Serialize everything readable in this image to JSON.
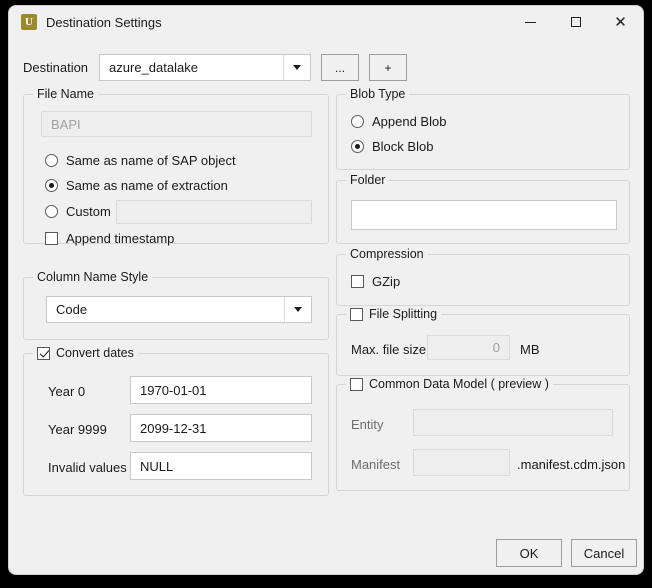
{
  "window": {
    "title": "Destination Settings",
    "app_icon": "u-logo-icon",
    "controls": {
      "minimize": "minimize-icon",
      "maximize": "maximize-icon",
      "close": "close-icon"
    }
  },
  "destination": {
    "label": "Destination",
    "value": "azure_datalake",
    "browse_label": "...",
    "add_label": "+"
  },
  "file_name": {
    "title": "File Name",
    "preview_value": "BAPI",
    "options": [
      {
        "label": "Same as name of SAP object",
        "checked": false
      },
      {
        "label": "Same as name of extraction",
        "checked": true
      },
      {
        "label": "Custom",
        "checked": false
      }
    ],
    "custom_value": "",
    "append_timestamp": {
      "label": "Append timestamp",
      "checked": false
    }
  },
  "column_name_style": {
    "title": "Column Name Style",
    "value": "Code"
  },
  "convert_dates": {
    "title": "Convert dates",
    "checked": true,
    "fields": [
      {
        "label": "Year 0",
        "value": "1970-01-01"
      },
      {
        "label": "Year 9999",
        "value": "2099-12-31"
      },
      {
        "label": "Invalid values",
        "value": "NULL"
      }
    ]
  },
  "blob_type": {
    "title": "Blob Type",
    "options": [
      {
        "label": "Append Blob",
        "checked": false
      },
      {
        "label": "Block Blob",
        "checked": true
      }
    ]
  },
  "folder": {
    "title": "Folder",
    "value": ""
  },
  "compression": {
    "title": "Compression",
    "gzip": {
      "label": "GZip",
      "checked": false
    }
  },
  "file_splitting": {
    "title": "File Splitting",
    "checked": false,
    "max_size_label": "Max. file size",
    "max_size_value": "0",
    "unit": "MB"
  },
  "common_data_model": {
    "title": "Common Data Model ( preview )",
    "checked": false,
    "entity_label": "Entity",
    "entity_value": "",
    "manifest_label": "Manifest",
    "manifest_value": "",
    "manifest_suffix": ".manifest.cdm.json"
  },
  "footer": {
    "ok_label": "OK",
    "cancel_label": "Cancel"
  },
  "colors": {
    "accent_icon": "#9b8b2c",
    "window_bg": "#f0f0f0",
    "border": "#d5d5d5"
  }
}
